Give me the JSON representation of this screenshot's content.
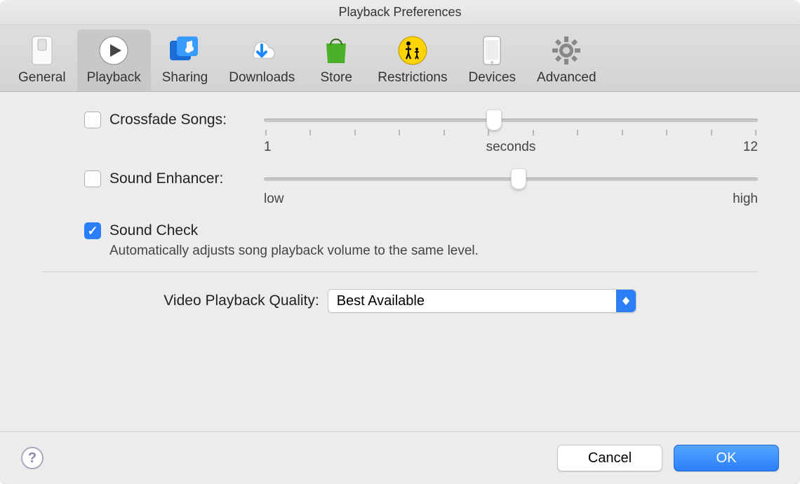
{
  "window": {
    "title": "Playback Preferences"
  },
  "toolbar": {
    "items": [
      {
        "id": "general",
        "label": "General",
        "icon": "switch-icon",
        "selected": false
      },
      {
        "id": "playback",
        "label": "Playback",
        "icon": "play-icon",
        "selected": true
      },
      {
        "id": "sharing",
        "label": "Sharing",
        "icon": "music-folder-icon",
        "selected": false
      },
      {
        "id": "downloads",
        "label": "Downloads",
        "icon": "cloud-download-icon",
        "selected": false
      },
      {
        "id": "store",
        "label": "Store",
        "icon": "shopping-bag-icon",
        "selected": false
      },
      {
        "id": "restrictions",
        "label": "Restrictions",
        "icon": "parental-icon",
        "selected": false
      },
      {
        "id": "devices",
        "label": "Devices",
        "icon": "phone-icon",
        "selected": false
      },
      {
        "id": "advanced",
        "label": "Advanced",
        "icon": "gear-icon",
        "selected": false
      }
    ]
  },
  "settings": {
    "crossfade": {
      "label": "Crossfade Songs:",
      "checked": false,
      "slider": {
        "min_label": "1",
        "center_label": "seconds",
        "max_label": "12",
        "ticks": 12,
        "position_pct": 45
      }
    },
    "enhancer": {
      "label": "Sound Enhancer:",
      "checked": false,
      "slider": {
        "min_label": "low",
        "max_label": "high",
        "ticks": 0,
        "position_pct": 50
      }
    },
    "soundcheck": {
      "label": "Sound Check",
      "checked": true,
      "description": "Automatically adjusts song playback volume to the same level."
    },
    "video_quality": {
      "label": "Video Playback Quality:",
      "selected": "Best Available"
    }
  },
  "footer": {
    "help_tooltip": "Help",
    "cancel": "Cancel",
    "ok": "OK"
  }
}
